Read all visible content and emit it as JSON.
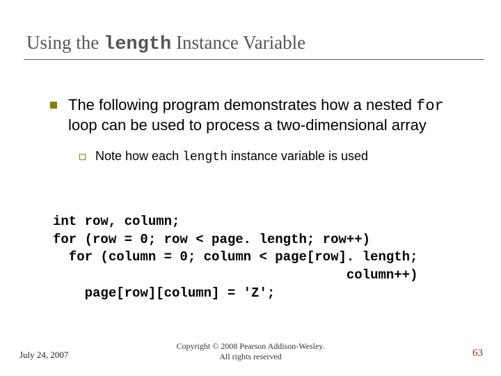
{
  "title": {
    "t1": "Using the ",
    "mono": "length",
    "t2": " Instance Variable"
  },
  "bullet": {
    "t1": "The following program demonstrates how a nested ",
    "mono": "for",
    "t2": " loop can be used to process a two-dimensional array"
  },
  "subbullet": {
    "t1": "Note how each ",
    "mono": "length",
    "t2": " instance variable is used"
  },
  "code": "int row, column;\nfor (row = 0; row < page. length; row++)\n  for (column = 0; column < page[row]. length;\n                                     column++)\n    page[row][column] = 'Z';",
  "footer": {
    "date": "July 24, 2007",
    "copy1": "Copyright © 2008 Pearson Addison-Wesley.",
    "copy2": "All rights reserved",
    "num": "63"
  }
}
